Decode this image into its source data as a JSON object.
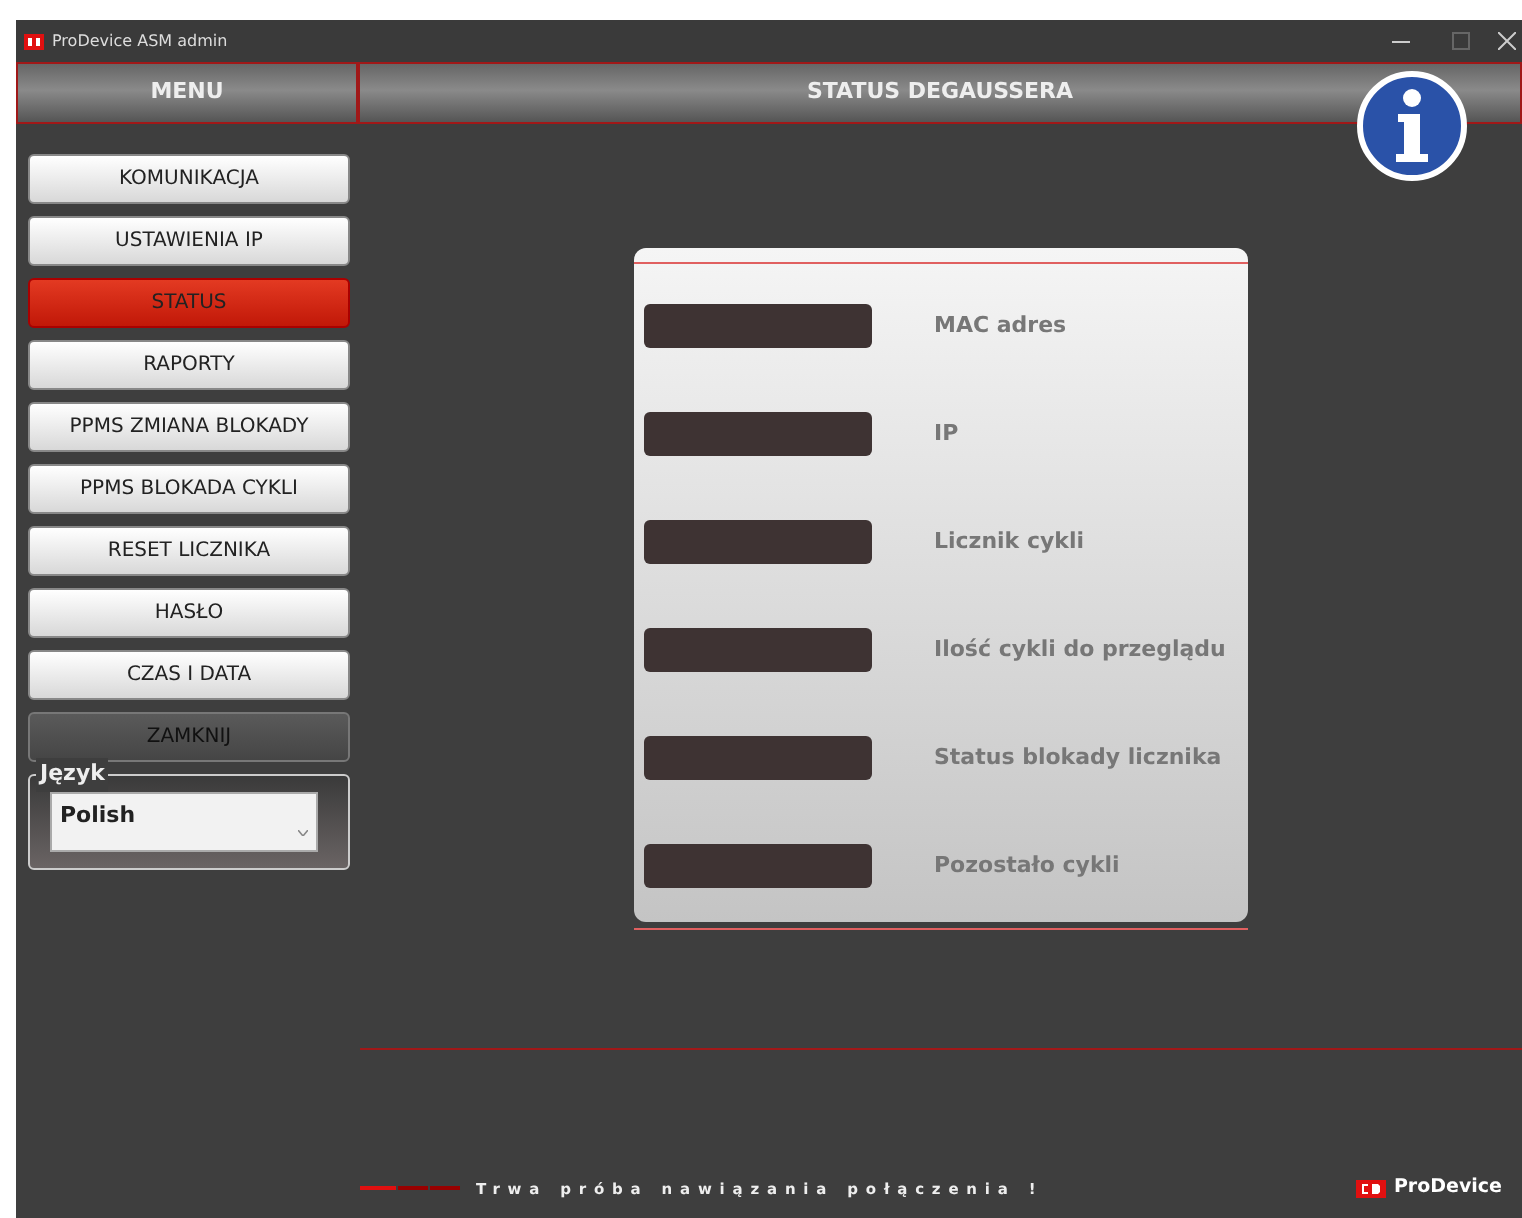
{
  "window": {
    "title": "ProDevice ASM admin"
  },
  "menu": {
    "title": "MENU",
    "items": [
      {
        "label": "KOMUNIKACJA",
        "kind": "nav",
        "selected": false
      },
      {
        "label": "USTAWIENIA IP",
        "kind": "nav",
        "selected": false
      },
      {
        "label": "STATUS",
        "kind": "nav",
        "selected": true
      },
      {
        "label": "RAPORTY",
        "kind": "nav",
        "selected": false
      },
      {
        "label": "PPMS ZMIANA BLOKADY",
        "kind": "nav",
        "selected": false
      },
      {
        "label": "PPMS BLOKADA CYKLI",
        "kind": "nav",
        "selected": false
      },
      {
        "label": "RESET LICZNIKA",
        "kind": "nav",
        "selected": false
      },
      {
        "label": "HASŁO",
        "kind": "nav",
        "selected": false
      },
      {
        "label": "CZAS I DATA",
        "kind": "nav",
        "selected": false
      },
      {
        "label": "ZAMKNIJ",
        "kind": "close",
        "selected": false
      }
    ],
    "language": {
      "legend": "Język",
      "value": "Polish"
    }
  },
  "page": {
    "title": "STATUS DEGAUSSERA",
    "fields": [
      {
        "label": "MAC adres"
      },
      {
        "label": "IP"
      },
      {
        "label": "Licznik cykli"
      },
      {
        "label": "Ilość cykli do przeglądu"
      },
      {
        "label": "Status blokady licznika"
      },
      {
        "label": "Pozostało cykli"
      }
    ]
  },
  "status_bar": {
    "message": "Trwa próba nawiązania połączenia !",
    "logo": "ProDevice"
  }
}
